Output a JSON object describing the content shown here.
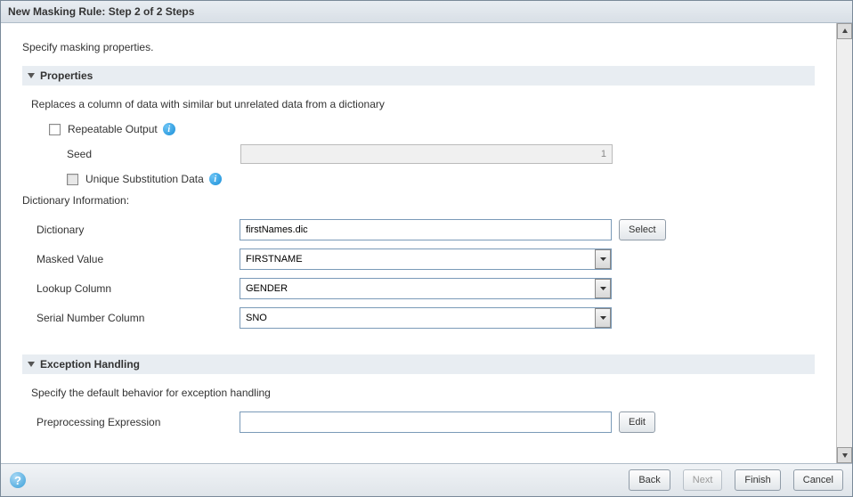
{
  "window": {
    "title": "New Masking Rule: Step 2 of 2 Steps"
  },
  "intro": "Specify masking properties.",
  "properties": {
    "header": "Properties",
    "description": "Replaces a column of data with similar but unrelated data from a dictionary",
    "repeatable_output_label": "Repeatable Output",
    "seed_label": "Seed",
    "seed_value": "1",
    "unique_substitution_label": "Unique Substitution Data",
    "dictionary_info_heading": "Dictionary Information:",
    "dictionary_label": "Dictionary",
    "dictionary_value": "firstNames.dic",
    "select_button": "Select",
    "masked_value_label": "Masked Value",
    "masked_value_value": "FIRSTNAME",
    "lookup_column_label": "Lookup Column",
    "lookup_column_value": "GENDER",
    "serial_number_label": "Serial Number Column",
    "serial_number_value": "SNO"
  },
  "exception": {
    "header": "Exception Handling",
    "description": "Specify the default behavior for exception handling",
    "preprocessing_label": "Preprocessing Expression",
    "preprocessing_value": "",
    "edit_button": "Edit"
  },
  "footer": {
    "help": "?",
    "back": "Back",
    "next": "Next",
    "finish": "Finish",
    "cancel": "Cancel"
  }
}
